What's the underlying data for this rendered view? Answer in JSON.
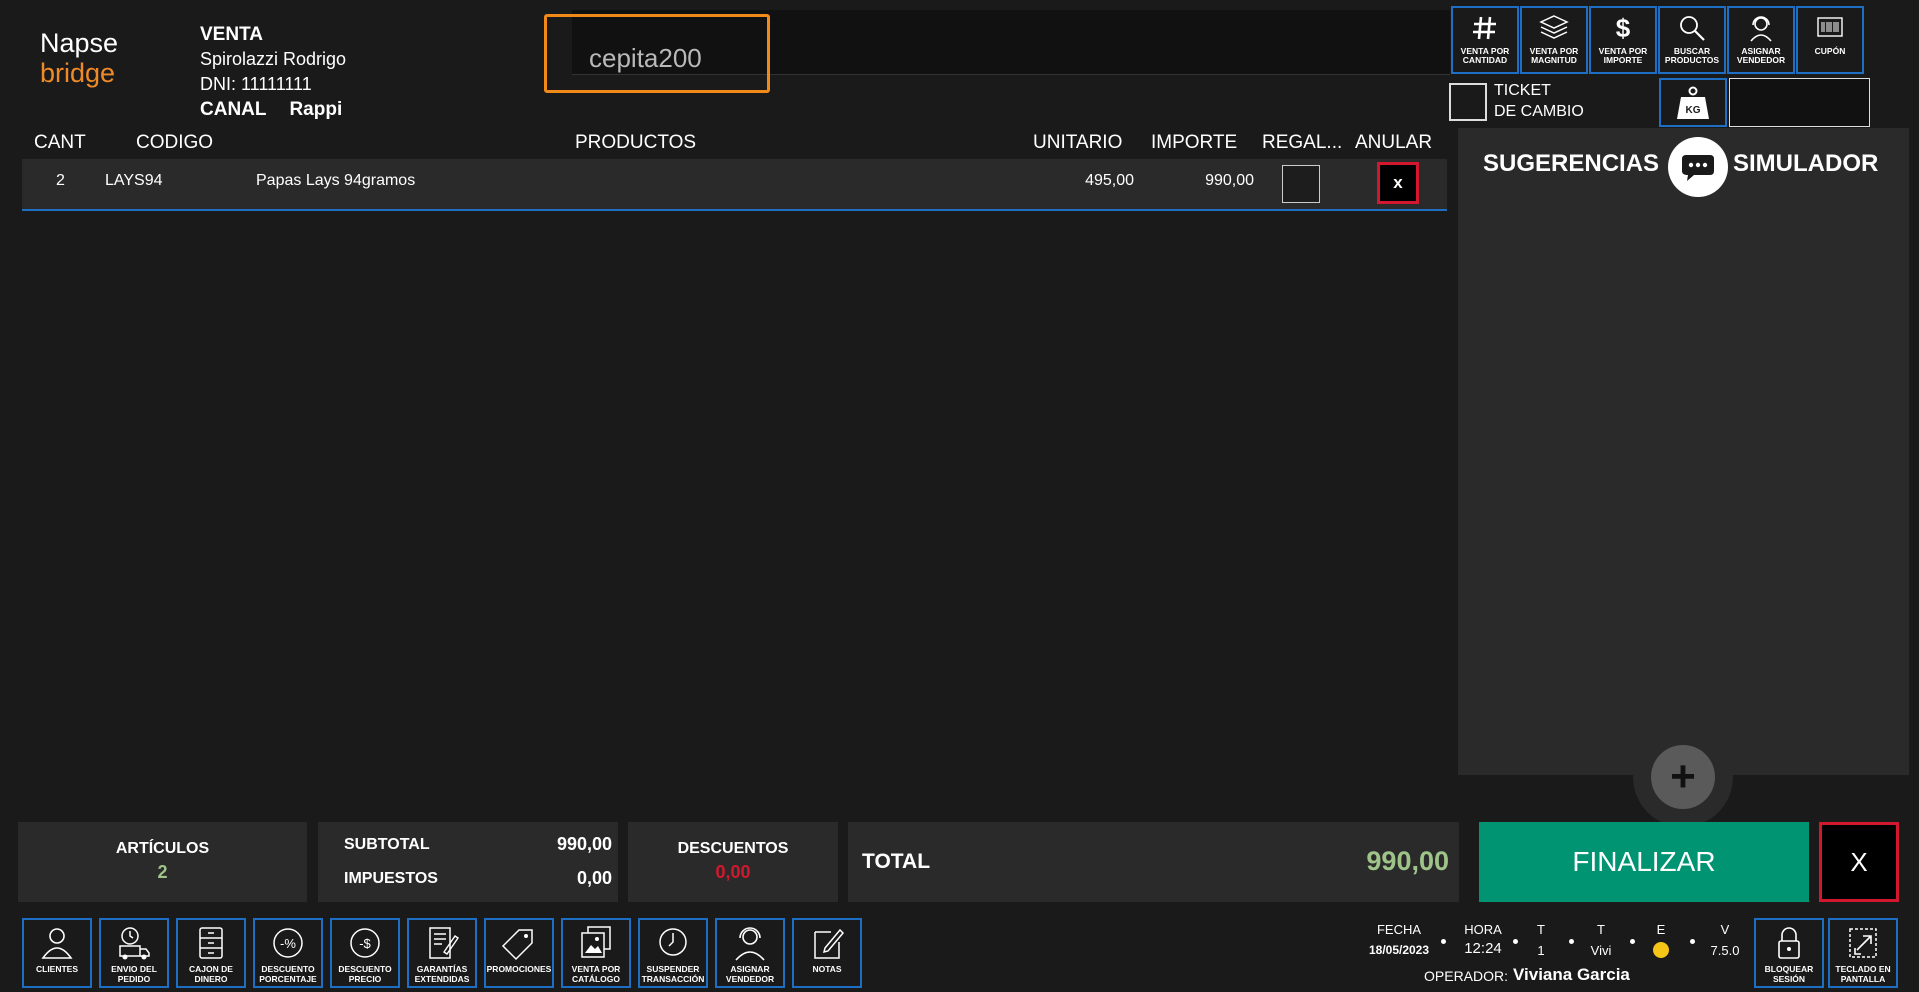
{
  "logo": {
    "line1": "Napse",
    "line2": "bridge"
  },
  "header": {
    "title": "VENTA",
    "customer": "Spirolazzi Rodrigo",
    "dni": "DNI: 11111111",
    "canal_label": "CANAL",
    "canal_value": "Rappi"
  },
  "search": {
    "value": "cepita200"
  },
  "toolbar": {
    "buttons": [
      {
        "label": "VENTA POR CANTIDAD",
        "icon": "hash-icon"
      },
      {
        "label": "VENTA POR MAGNITUD",
        "icon": "layers-icon"
      },
      {
        "label": "VENTA POR IMPORTE",
        "icon": "dollar-icon"
      },
      {
        "label": "BUSCAR PRODUCTOS",
        "icon": "search-icon"
      },
      {
        "label": "ASIGNAR VENDEDOR",
        "icon": "headset-icon"
      },
      {
        "label": "CUPÓN",
        "icon": "barcode-icon"
      }
    ],
    "ticket_label_1": "TICKET",
    "ticket_label_2": "DE CAMBIO",
    "kg_label": "KG"
  },
  "table": {
    "headers": {
      "cant": "CANT",
      "codigo": "CODIGO",
      "productos": "PRODUCTOS",
      "unitario": "UNITARIO",
      "importe": "IMPORTE",
      "regalo": "REGAL...",
      "anular": "ANULAR"
    },
    "rows": [
      {
        "cant": "2",
        "codigo": "LAYS94",
        "producto": "Papas Lays 94gramos",
        "unitario": "495,00",
        "importe": "990,00",
        "anular": "x"
      }
    ]
  },
  "sidebar": {
    "sugerencias": "SUGERENCIAS",
    "simulador": "SIMULADOR",
    "add": "+"
  },
  "totals": {
    "articulos_label": "ARTÍCULOS",
    "articulos_value": "2",
    "subtotal_label": "SUBTOTAL",
    "subtotal_value": "990,00",
    "impuestos_label": "IMPUESTOS",
    "impuestos_value": "0,00",
    "descuentos_label": "DESCUENTOS",
    "descuentos_value": "0,00",
    "total_label": "TOTAL",
    "total_value": "990,00",
    "finalizar": "FINALIZAR",
    "cancel": "X"
  },
  "bottom": {
    "buttons": [
      {
        "label": "CLIENTES",
        "icon": "person-icon"
      },
      {
        "label": "ENVIO DEL PEDIDO",
        "icon": "delivery-truck-icon"
      },
      {
        "label": "CAJON DE DINERO",
        "icon": "cash-drawer-icon"
      },
      {
        "label": "DESCUENTO PORCENTAJE",
        "icon": "percent-discount-icon"
      },
      {
        "label": "DESCUENTO PRECIO",
        "icon": "price-discount-icon"
      },
      {
        "label": "GARANTÍAS EXTENDIDAS",
        "icon": "warranty-icon"
      },
      {
        "label": "PROMOCIONES",
        "icon": "tag-icon"
      },
      {
        "label": "VENTA POR CATÁLOGO",
        "icon": "catalog-icon"
      },
      {
        "label": "SUSPENDER TRANSACCIÓN",
        "icon": "clock-icon"
      },
      {
        "label": "ASIGNAR VENDEDOR",
        "icon": "headset-icon"
      },
      {
        "label": "NOTAS",
        "icon": "notes-icon"
      }
    ],
    "lock": {
      "label": "BLOQUEAR SESIÓN",
      "icon": "lock-icon"
    },
    "keyboard": {
      "label": "TECLADO EN PANTALLA",
      "icon": "expand-icon"
    }
  },
  "status": {
    "fecha_label": "FECHA",
    "fecha": "18/05/2023",
    "hora_label": "HORA",
    "hora": "12:24",
    "t1_label": "T",
    "t1": "1",
    "t2_label": "T",
    "t2": "Vivi",
    "e_label": "E",
    "v_label": "V",
    "v": "7.5.0",
    "operador_label": "OPERADOR:",
    "operador": "Viviana Garcia"
  },
  "colors": {
    "accent_blue": "#1e6fc4",
    "orange": "#f28a1a",
    "green": "#009473",
    "red": "#d1182f",
    "status_yellow": "#f5c518"
  }
}
